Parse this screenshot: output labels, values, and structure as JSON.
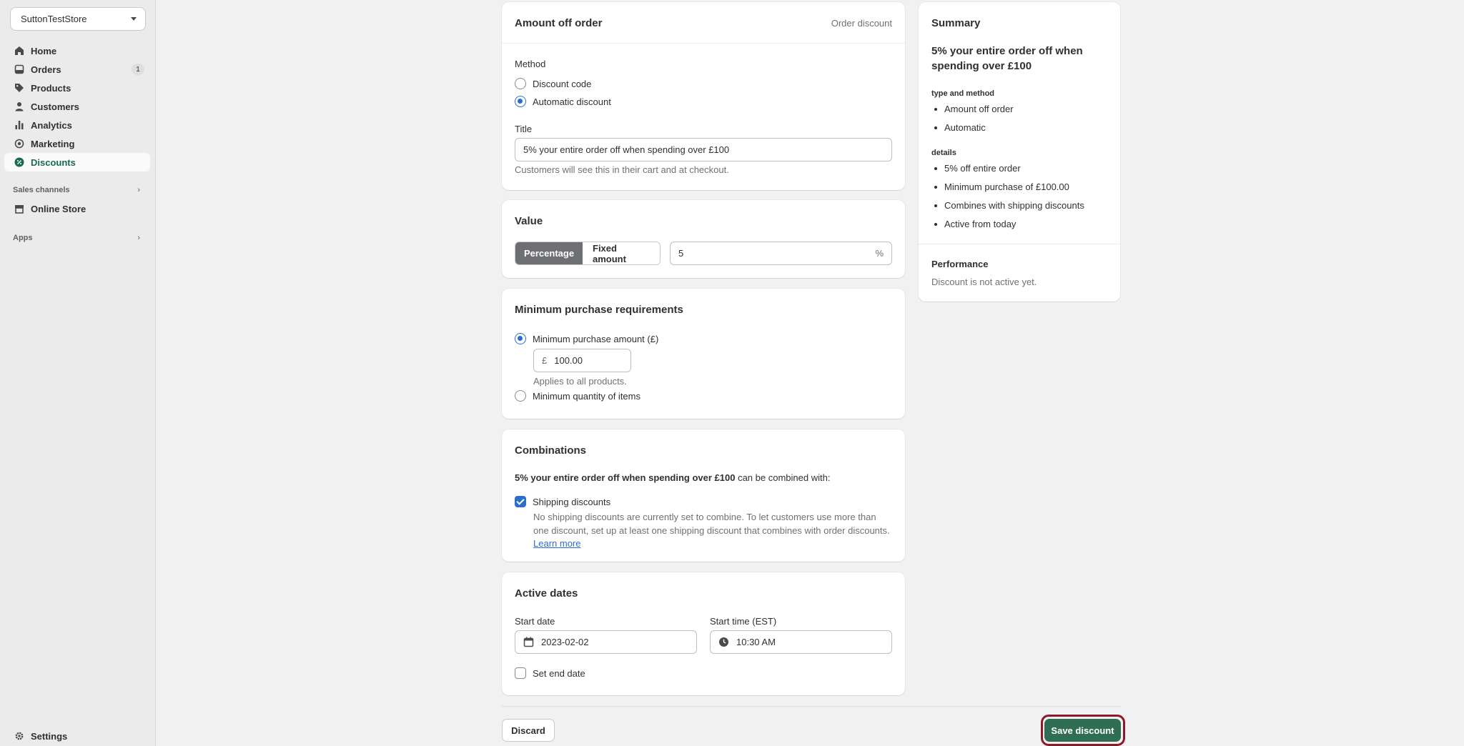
{
  "sidebar": {
    "store_name": "SuttonTestStore",
    "items": [
      {
        "label": "Home",
        "icon": "home-icon"
      },
      {
        "label": "Orders",
        "icon": "orders-icon",
        "badge": "1"
      },
      {
        "label": "Products",
        "icon": "tag-icon"
      },
      {
        "label": "Customers",
        "icon": "person-icon"
      },
      {
        "label": "Analytics",
        "icon": "bar-chart-icon"
      },
      {
        "label": "Marketing",
        "icon": "target-icon"
      },
      {
        "label": "Discounts",
        "icon": "discount-icon",
        "active": true
      }
    ],
    "sales_channels_label": "Sales channels",
    "online_store_label": "Online Store",
    "apps_label": "Apps",
    "settings_label": "Settings"
  },
  "amount_off": {
    "title": "Amount off order",
    "type_label": "Order discount",
    "method_label": "Method",
    "method_options": [
      "Discount code",
      "Automatic discount"
    ],
    "method_selected": "Automatic discount",
    "title_label": "Title",
    "title_value": "5% your entire order off when spending over £100",
    "title_help": "Customers will see this in their cart and at checkout."
  },
  "value": {
    "title": "Value",
    "percentage_label": "Percentage",
    "fixed_label": "Fixed amount",
    "amount": "5",
    "suffix": "%"
  },
  "minimum": {
    "title": "Minimum purchase requirements",
    "option_amount": "Minimum purchase amount (£)",
    "currency": "£",
    "amount_value": "100.00",
    "help": "Applies to all products.",
    "option_quantity": "Minimum quantity of items"
  },
  "combinations": {
    "title": "Combinations",
    "lead_bold": "5% your entire order off when spending over £100",
    "lead_rest": " can be combined with:",
    "shipping_label": "Shipping discounts",
    "shipping_help": "No shipping discounts are currently set to combine. To let customers use more than one discount, set up at least one shipping discount that combines with order discounts. ",
    "learn_more": "Learn more"
  },
  "active_dates": {
    "title": "Active dates",
    "start_date_label": "Start date",
    "start_date": "2023-02-02",
    "start_time_label": "Start time (EST)",
    "start_time": "10:30 AM",
    "end_date_label": "Set end date"
  },
  "summary": {
    "title": "Summary",
    "headline": "5% your entire order off when spending over £100",
    "type_heading": "type and method",
    "type_items": [
      "Amount off order",
      "Automatic"
    ],
    "details_heading": "details",
    "detail_items": [
      "5% off entire order",
      "Minimum purchase of £100.00",
      "Combines with shipping discounts",
      "Active from today"
    ],
    "performance_title": "Performance",
    "performance_text": "Discount is not active yet."
  },
  "footer": {
    "discard_label": "Discard",
    "save_label": "Save discount"
  },
  "colors": {
    "accent": "#2c6ecb",
    "save_green": "#2f6e52",
    "highlight_ring": "#8b1a2b",
    "active_nav": "#1a6b4c"
  }
}
